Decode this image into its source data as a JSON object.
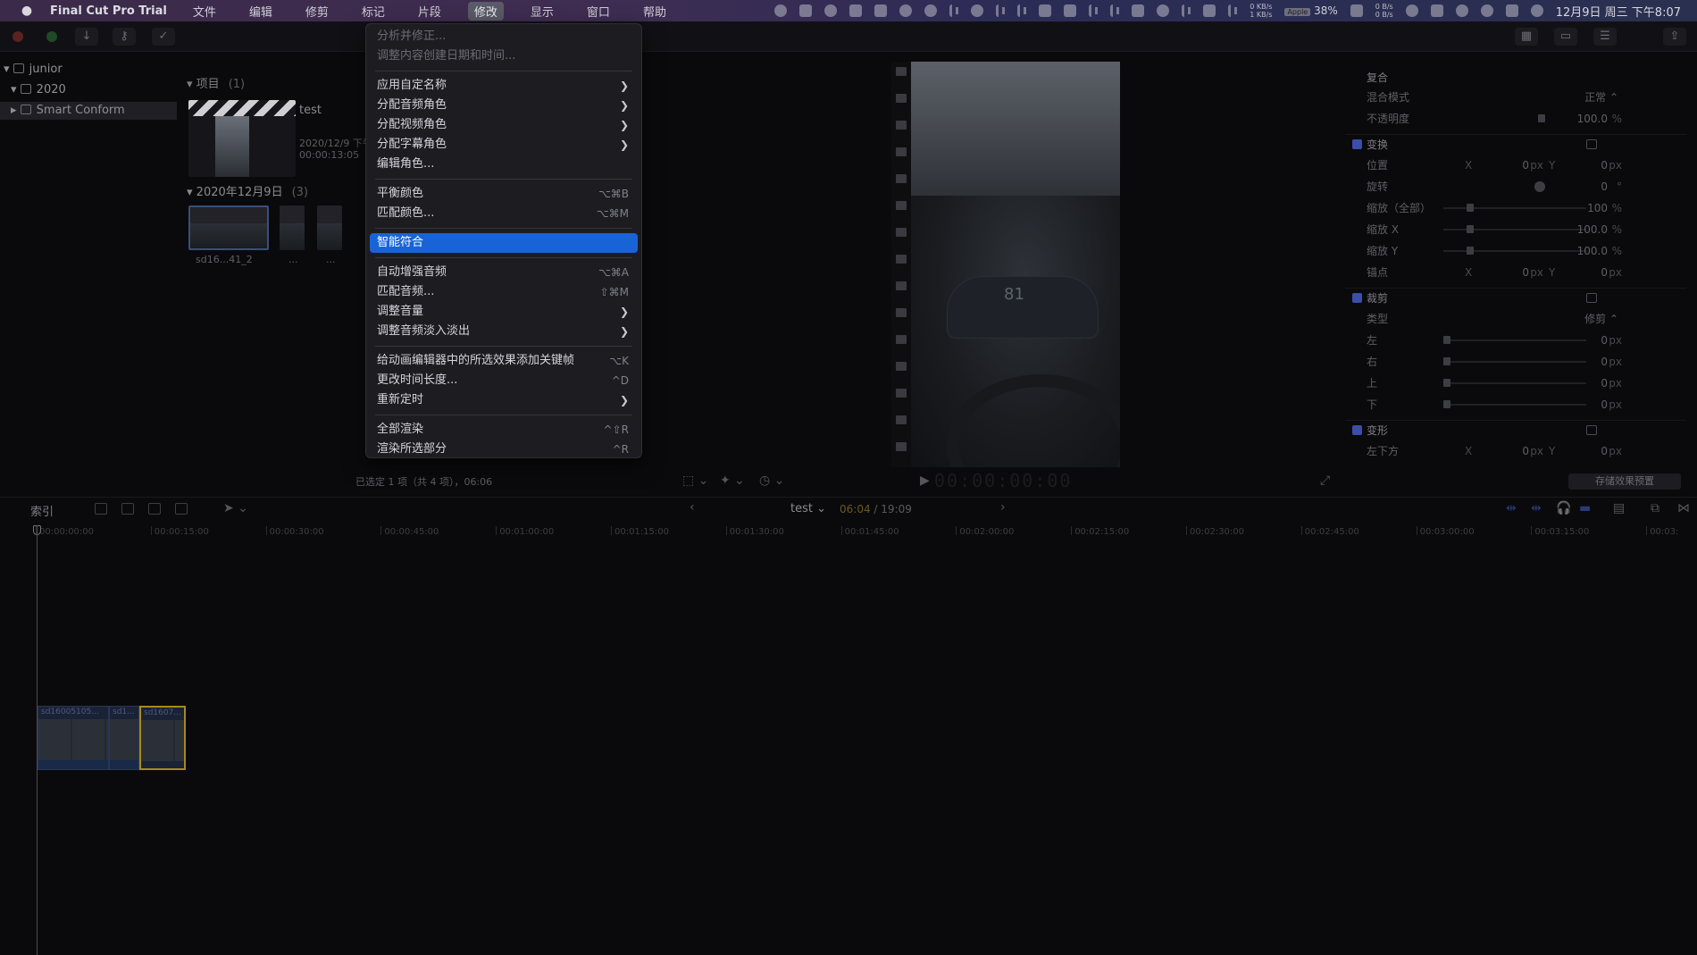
{
  "menubar": {
    "apple": "",
    "app_name": "Final Cut Pro Trial",
    "items": [
      "文件",
      "编辑",
      "修剪",
      "标记",
      "片段",
      "修改",
      "显示",
      "窗口",
      "帮助"
    ],
    "network_up": "0 KB/s",
    "network_down": "1 KB/s",
    "battery_badge": "Apple",
    "battery_percent": "38%",
    "network2_up": "0 B/s",
    "network2_down": "0 B/s",
    "datetime": "12月9日 周三 下午8:07"
  },
  "library": {
    "items": [
      {
        "label": "junior"
      },
      {
        "label": "2020"
      },
      {
        "label": "Smart Conform"
      }
    ]
  },
  "browser": {
    "projects_heading": "项目",
    "projects_count": "(1)",
    "project_name": "test",
    "project_date": "2020/12/9 下午",
    "project_duration": "00:00:13:05",
    "event_heading": "2020年12月9日",
    "event_count": "(3)",
    "clip_label_1": "sd16...41_2",
    "clip_label_2": "...",
    "clip_label_3": "..."
  },
  "status_info": "已选定 1 项（共 4 项），06:06",
  "viewer": {
    "speed": "81",
    "timecode": "00:00:00:00"
  },
  "inspector": {
    "compositing": "复合",
    "blend_mode_label": "混合模式",
    "blend_mode_value": "正常 ⌃",
    "opacity_label": "不透明度",
    "opacity_value": "100.0",
    "transform": "变换",
    "position_label": "位置",
    "rotation_label": "旋转",
    "rotation_value": "0",
    "scale_all_label": "缩放（全部）",
    "scale_all_value": "100",
    "scale_x_label": "缩放 X",
    "scale_x_value": "100.0",
    "scale_y_label": "缩放 Y",
    "scale_y_value": "100.0",
    "anchor_label": "锚点",
    "crop": "裁剪",
    "crop_type_label": "类型",
    "crop_type_value": "修剪 ⌃",
    "left_label": "左",
    "right_label": "右",
    "top_label": "上",
    "bottom_label": "下",
    "distort": "变形",
    "bottom_left_label": "左下方",
    "x_label": "X",
    "y_label": "Y",
    "zero": "0",
    "unit_px": "px",
    "unit_pct": "%",
    "unit_deg": "°",
    "save_preset": "存储效果预置"
  },
  "timeline": {
    "index_label": "索引",
    "project_name": "test",
    "duration_current": "06:04",
    "duration_total": " / 19:09",
    "ruler": [
      "00:00:00:00",
      "00:00:15:00",
      "00:00:30:00",
      "00:00:45:00",
      "00:01:00:00",
      "00:01:15:00",
      "00:01:30:00",
      "00:01:45:00",
      "00:02:00:00",
      "00:02:15:00",
      "00:02:30:00",
      "00:02:45:00",
      "00:03:00:00",
      "00:03:15:00",
      "00:03:"
    ],
    "clips": [
      {
        "name": "sd16005105..."
      },
      {
        "name": "sd1..."
      },
      {
        "name": "sd1607..."
      }
    ]
  },
  "menu": {
    "items": [
      {
        "label": "分析并修正...",
        "shortcut": "",
        "submenu": false,
        "disabled": true
      },
      {
        "label": "调整内容创建日期和时间...",
        "shortcut": "",
        "submenu": false,
        "disabled": true
      },
      {
        "label": "应用自定名称",
        "shortcut": "",
        "submenu": true,
        "disabled": false
      },
      {
        "label": "分配音频角色",
        "shortcut": "",
        "submenu": true,
        "disabled": false
      },
      {
        "label": "分配视频角色",
        "shortcut": "",
        "submenu": true,
        "disabled": false
      },
      {
        "label": "分配字幕角色",
        "shortcut": "",
        "submenu": true,
        "disabled": false
      },
      {
        "label": "编辑角色...",
        "shortcut": "",
        "submenu": false,
        "disabled": false
      },
      {
        "label": "平衡颜色",
        "shortcut": "⌥⌘B",
        "submenu": false,
        "disabled": false
      },
      {
        "label": "匹配颜色...",
        "shortcut": "⌥⌘M",
        "submenu": false,
        "disabled": false
      },
      {
        "label": "智能符合",
        "shortcut": "",
        "submenu": false,
        "disabled": false,
        "highlighted": true
      },
      {
        "label": "自动增强音频",
        "shortcut": "⌥⌘A",
        "submenu": false,
        "disabled": false
      },
      {
        "label": "匹配音频...",
        "shortcut": "⇧⌘M",
        "submenu": false,
        "disabled": false
      },
      {
        "label": "调整音量",
        "shortcut": "",
        "submenu": true,
        "disabled": false
      },
      {
        "label": "调整音频淡入淡出",
        "shortcut": "",
        "submenu": true,
        "disabled": false
      },
      {
        "label": "给动画编辑器中的所选效果添加关键帧",
        "shortcut": "⌥K",
        "submenu": false,
        "disabled": false
      },
      {
        "label": "更改时间长度...",
        "shortcut": "^D",
        "submenu": false,
        "disabled": false
      },
      {
        "label": "重新定时",
        "shortcut": "",
        "submenu": true,
        "disabled": false
      },
      {
        "label": "全部渲染",
        "shortcut": "^⇧R",
        "submenu": false,
        "disabled": false
      },
      {
        "label": "渲染所选部分",
        "shortcut": "^R",
        "submenu": false,
        "disabled": false
      }
    ]
  },
  "colors": {
    "menu_highlight": "#1864d6",
    "menubar_bg": "#3f2d52",
    "clip_selected_border": "#a68a1c"
  }
}
